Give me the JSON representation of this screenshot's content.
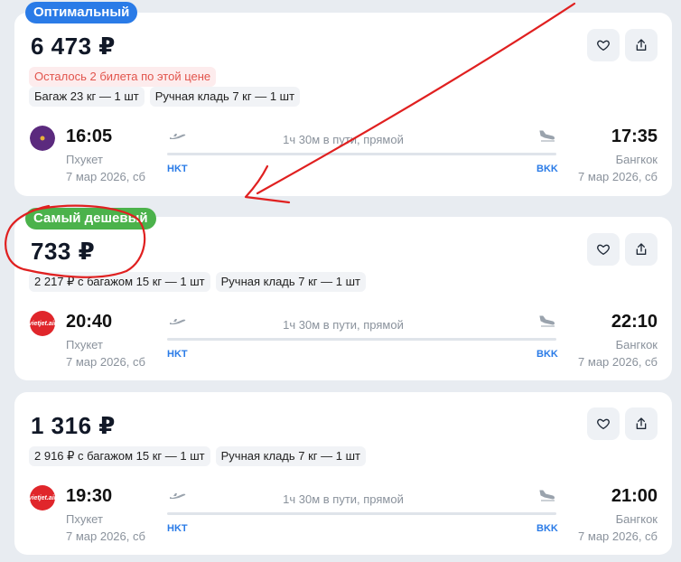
{
  "tickets": [
    {
      "badge": "Оптимальный",
      "badge_color": "#2a7be7",
      "price": "6 473 ₽",
      "warning": "Осталось 2 билета по этой цене",
      "tags": [
        "Багаж 23 кг — 1 шт",
        "Ручная кладь 7 кг — 1 шт"
      ],
      "airline_icon": "thai-airways-logo-icon",
      "dep_time": "16:05",
      "dep_city": "Пхукет",
      "dep_date": "7 мар 2026, сб",
      "dep_code": "HKT",
      "duration": "1ч 30м в пути, прямой",
      "arr_time": "17:35",
      "arr_city": "Бангкок",
      "arr_date": "7 мар 2026, сб",
      "arr_code": "BKK"
    },
    {
      "badge": "Самый дешевый",
      "badge_color": "#4bb24b",
      "price": "733 ₽",
      "tags": [
        "2 217 ₽ с багажом 15 кг — 1 шт",
        "Ручная кладь 7 кг — 1 шт"
      ],
      "airline_icon": "vietjet-logo-icon",
      "airline_logo_text": "vietjet.air",
      "dep_time": "20:40",
      "dep_city": "Пхукет",
      "dep_date": "7 мар 2026, сб",
      "dep_code": "HKT",
      "duration": "1ч 30м в пути, прямой",
      "arr_time": "22:10",
      "arr_city": "Бангкок",
      "arr_date": "7 мар 2026, сб",
      "arr_code": "BKK"
    },
    {
      "price": "1 316 ₽",
      "tags": [
        "2 916 ₽ с багажом 15 кг — 1 шт",
        "Ручная кладь 7 кг — 1 шт"
      ],
      "airline_icon": "vietjet-logo-icon",
      "airline_logo_text": "vietjet.air",
      "dep_time": "19:30",
      "dep_city": "Пхукет",
      "dep_date": "7 мар 2026, сб",
      "dep_code": "HKT",
      "duration": "1ч 30м в пути, прямой",
      "arr_time": "21:00",
      "arr_city": "Бангкок",
      "arr_date": "7 мар 2026, сб",
      "arr_code": "BKK"
    }
  ],
  "colors": {
    "accent": "#2a7be7",
    "cheapest": "#4bb24b",
    "warning_text": "#e2544c",
    "annotation": "#e02020"
  }
}
